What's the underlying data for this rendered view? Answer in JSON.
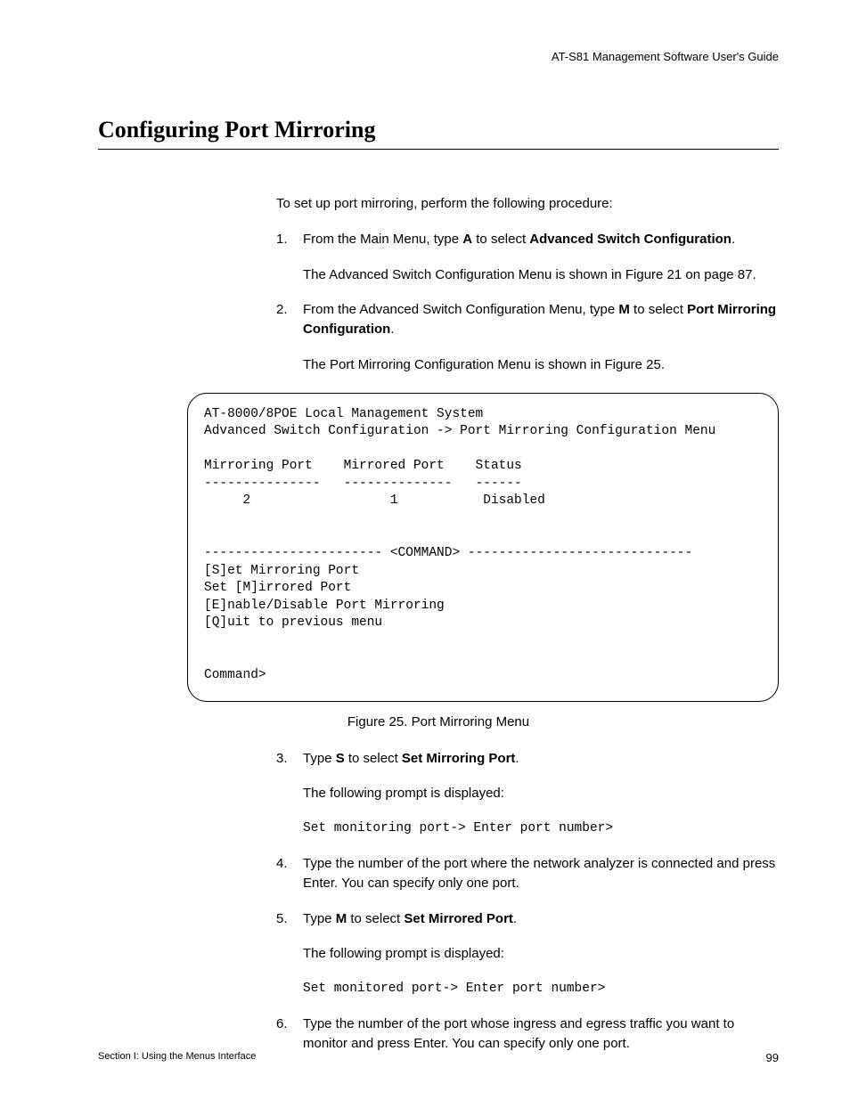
{
  "header": {
    "guide_title": "AT-S81 Management Software User's Guide"
  },
  "section": {
    "title": "Configuring Port Mirroring"
  },
  "intro": "To set up port mirroring, perform the following procedure:",
  "steps": {
    "s1": {
      "pre": "From the Main Menu, type ",
      "key": "A",
      "mid": " to select ",
      "bold": "Advanced Switch Configuration",
      "post": ".",
      "sub": "The Advanced Switch Configuration Menu is shown in Figure 21 on page 87."
    },
    "s2": {
      "pre": "From the Advanced Switch Configuration Menu, type ",
      "key": "M",
      "mid": " to select ",
      "bold": "Port Mirroring Configuration",
      "post": ".",
      "sub": "The Port Mirroring Configuration Menu is shown in Figure 25."
    },
    "s3": {
      "pre": "Type ",
      "key": "S",
      "mid": " to select ",
      "bold": "Set Mirroring Port",
      "post": ".",
      "sub": "The following prompt is displayed:",
      "mono": "Set monitoring port-> Enter port number>"
    },
    "s4": {
      "text": "Type the number of the port where the network analyzer is connected and press Enter. You can specify only one port."
    },
    "s5": {
      "pre": "Type ",
      "key": "M",
      "mid": " to select ",
      "bold": "Set Mirrored Port",
      "post": ".",
      "sub": "The following prompt is displayed:",
      "mono": "Set monitored port-> Enter port number>"
    },
    "s6": {
      "text": "Type the number of the port whose ingress and egress traffic you want to monitor and press Enter. You can specify only one port."
    }
  },
  "terminal": {
    "l1": "AT-8000/8POE Local Management System",
    "l2": "Advanced Switch Configuration -> Port Mirroring Configuration Menu",
    "l3": "",
    "l4": "Mirroring Port    Mirrored Port    Status",
    "l5": "---------------   --------------   ------",
    "l6": "     2                  1           Disabled",
    "l7": "",
    "l8": "",
    "l9": "----------------------- <COMMAND> -----------------------------",
    "l10": "[S]et Mirroring Port",
    "l11": "Set [M]irrored Port",
    "l12": "[E]nable/Disable Port Mirroring",
    "l13": "[Q]uit to previous menu",
    "l14": "",
    "l15": "",
    "l16": "Command>"
  },
  "figure_caption": "Figure 25. Port Mirroring Menu",
  "footer": {
    "section": "Section I: Using the Menus Interface",
    "page": "99"
  }
}
